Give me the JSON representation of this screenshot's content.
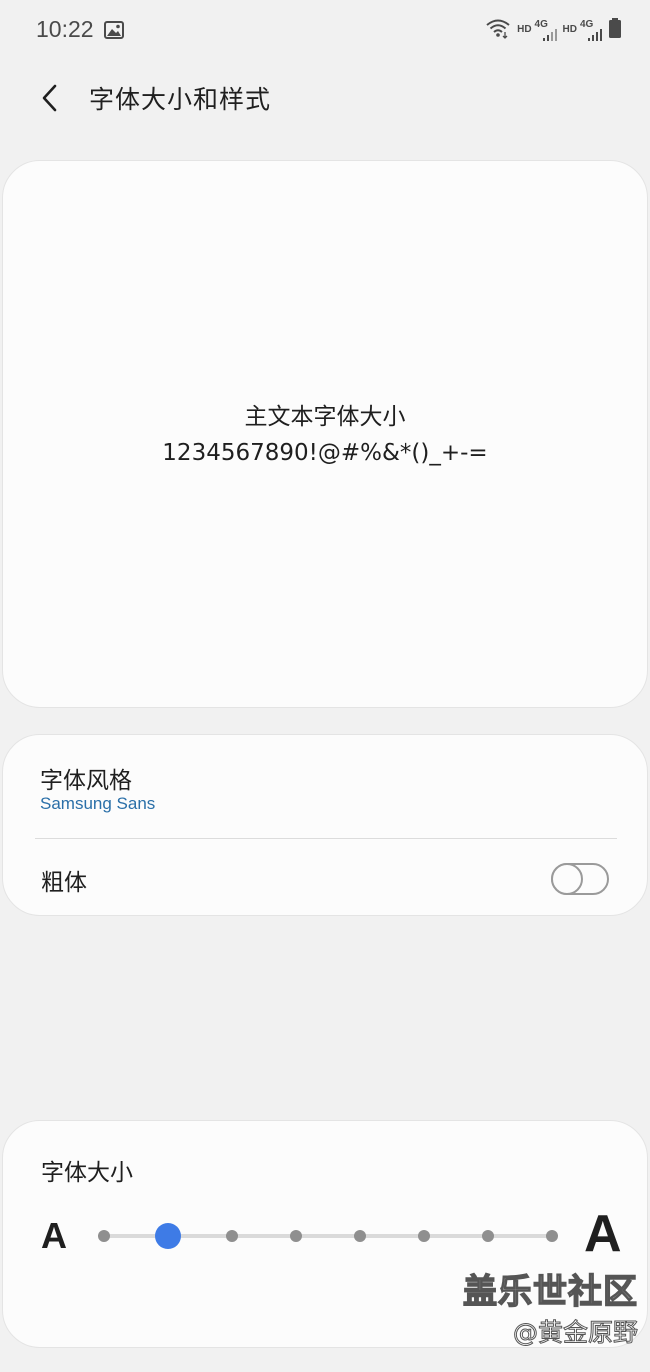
{
  "status_bar": {
    "time": "10:22",
    "net1": {
      "hd": "HD",
      "type": "4G"
    },
    "net2": {
      "hd": "HD",
      "type": "4G"
    },
    "icons": [
      "gallery-icon",
      "wifi-icon",
      "signal-icon",
      "signal-icon",
      "battery-icon"
    ]
  },
  "header": {
    "title": "字体大小和样式",
    "back_icon": "back-arrow-icon"
  },
  "preview": {
    "line1": "主文本字体大小",
    "line2": "1234567890!@#%&*()_+-="
  },
  "font_style": {
    "label": "字体风格",
    "value": "Samsung Sans"
  },
  "bold": {
    "label": "粗体",
    "enabled": false
  },
  "font_size": {
    "label": "字体大小",
    "small_label": "A",
    "large_label": "A",
    "levels": 8,
    "selected_level": 2
  },
  "watermark": {
    "main": "盖乐世社区",
    "sub": "@黄金原野"
  },
  "colors": {
    "background": "#f1f1f1",
    "card": "#fcfcfc",
    "accent": "#3e7be6",
    "link": "#2a6fa8"
  }
}
